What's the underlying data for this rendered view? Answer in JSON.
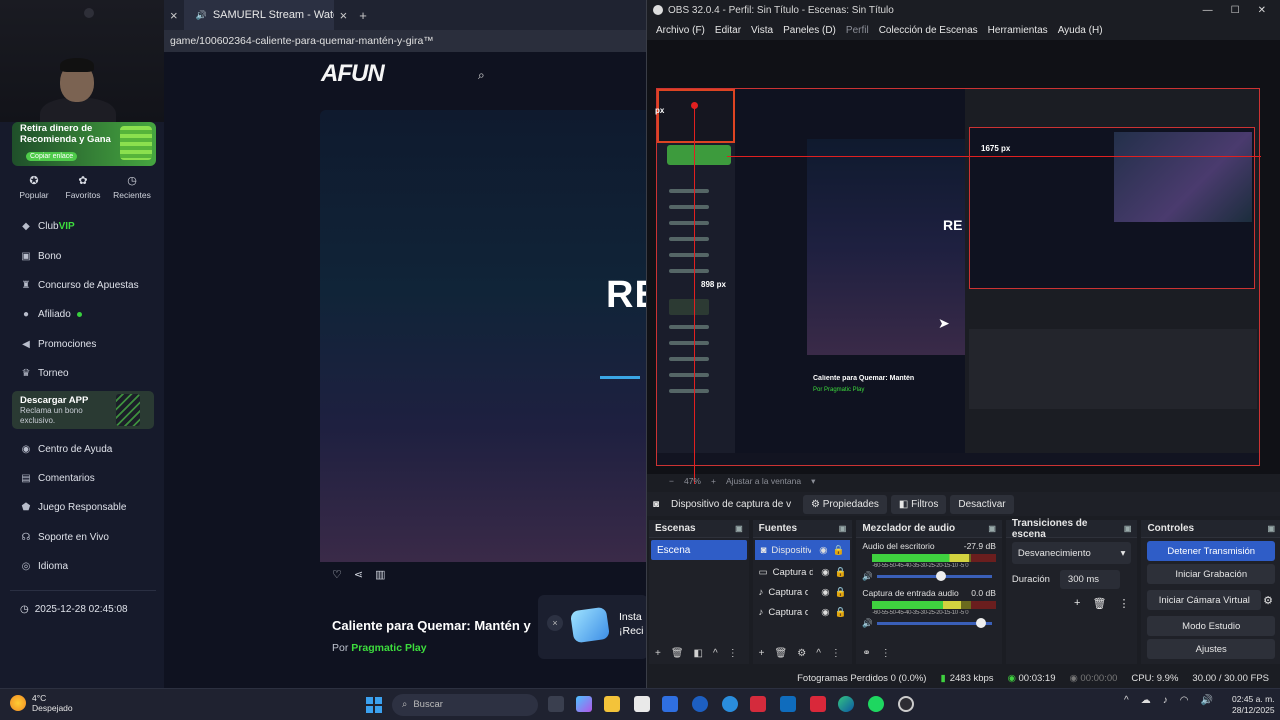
{
  "browser": {
    "tab": {
      "title": "SAMUERL Stream - Watch Li",
      "close": "×",
      "new": "+"
    },
    "tab_prev_close": "×",
    "url": "game/100602364-caliente-para-quemar-mantén-y-gira™"
  },
  "site": {
    "logo": "AFUN",
    "promo": {
      "title": "Retira dinero de Recomienda y Gana",
      "button": "Copiar enlace"
    },
    "quick": [
      {
        "label": "Popular",
        "icon": "star-icon"
      },
      {
        "label": "Favoritos",
        "icon": "heart-icon"
      },
      {
        "label": "Recientes",
        "icon": "clock-icon"
      }
    ],
    "menu": {
      "club_prefix": "Club ",
      "club_vip": "VIP",
      "bono": "Bono",
      "concurso": "Concurso de Apuestas",
      "afiliado": "Afiliado",
      "promociones": "Promociones",
      "torneo": "Torneo",
      "centro": "Centro de Ayuda",
      "comentarios": "Comentarios",
      "juego": "Juego Responsable",
      "soporte": "Soporte en Vivo",
      "idioma": "Idioma"
    },
    "download": {
      "title": "Descargar APP",
      "subtitle": "Reclama un bono exclusivo."
    },
    "datetime": "2025-12-28 02:45:08",
    "game": {
      "overlay": "RE",
      "title": "Caliente para Quemar: Mantén y",
      "provider_prefix": "Por ",
      "provider": "Pragmatic Play"
    },
    "install": {
      "line1": "Insta",
      "line2": "¡Reci",
      "close": "×"
    }
  },
  "obs": {
    "title": "OBS 32.0.4 - Perfil: Sin Título - Escenas: Sin Título",
    "menu": [
      "Archivo (F)",
      "Editar",
      "Vista",
      "Paneles (D)",
      "Perfil",
      "Colección de Escenas",
      "Herramientas",
      "Ayuda (H)"
    ],
    "preview": {
      "width_label": "1675 px",
      "height_label": "898 px",
      "px_label": "px",
      "mini_re": "RE",
      "mini_title": "Caliente para Quemar: Mantén y",
      "mini_provider": "Por Pragmatic Play"
    },
    "zoom": {
      "percent": "47%",
      "fit": "Ajustar a la ventana"
    },
    "source_bar": {
      "name": "Dispositivo de captura de v",
      "properties": "Propiedades",
      "filters": "Filtros",
      "deactivate": "Desactivar"
    },
    "docks": {
      "scenes": {
        "title": "Escenas",
        "items": [
          "Escena"
        ]
      },
      "sources": {
        "title": "Fuentes",
        "items": [
          "Dispositiv",
          "Captura d",
          "Captura d",
          "Captura d"
        ]
      },
      "mixer": {
        "title": "Mezclador de audio",
        "channels": [
          {
            "name": "Audio del escritorio",
            "db": "-27.9 dB",
            "level": 0.78,
            "volume": 0.6
          },
          {
            "name": "Captura de entrada audio",
            "db": "0.0 dB",
            "level": 0.72,
            "volume": 0.95
          }
        ],
        "scale": "-60-55-50-45-40-35-30-25-20-15-10 -5 0"
      },
      "transitions": {
        "title": "Transiciones de escena",
        "selected": "Desvanecimiento",
        "duration_label": "Duración",
        "duration": "300 ms"
      },
      "controls": {
        "title": "Controles",
        "buttons": [
          "Detener Transmisión",
          "Iniciar Grabación",
          "Iniciar Cámara Virtual",
          "Modo Estudio",
          "Ajustes"
        ]
      }
    },
    "status": {
      "dropped": "Fotogramas Perdidos 0 (0.0%)",
      "bitrate": "2483 kbps",
      "stream_time": "00:03:19",
      "rec_time": "00:00:00",
      "cpu": "CPU: 9.9%",
      "fps": "30.00 / 30.00 FPS"
    }
  },
  "taskbar": {
    "weather": {
      "temp": "4°C",
      "desc": "Despejado"
    },
    "search": "Buscar",
    "time": "02:45 a. m.",
    "date": "28/12/2025"
  }
}
